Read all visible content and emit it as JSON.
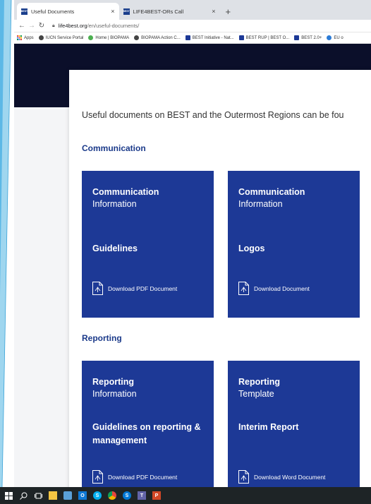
{
  "browser": {
    "tabs": [
      {
        "label": "Useful Documents",
        "favicon": "BEST",
        "active": true
      },
      {
        "label": "LIFE4BEST-ORs Call",
        "favicon": "BEST",
        "active": false
      }
    ],
    "new_tab": "+",
    "close_glyph": "×",
    "url_host": "life4best.org",
    "url_path": "/en/useful-documents/",
    "bookmarks": [
      {
        "label": "Apps",
        "icon": "apps-grid-icon",
        "color": "#e8453c"
      },
      {
        "label": "IUCN Service Portal",
        "icon": "globe-icon",
        "color": "#444444"
      },
      {
        "label": "Home | BIOPAMA",
        "icon": "biopama-icon",
        "color": "#4caf50"
      },
      {
        "label": "BIOPAMA Action C...",
        "icon": "globe-icon",
        "color": "#444444"
      },
      {
        "label": "BEST Initiative - Nat...",
        "icon": "eu-flag-icon",
        "color": "#1d3996"
      },
      {
        "label": "BEST RUP | BEST O...",
        "icon": "best-icon",
        "color": "#1d3996"
      },
      {
        "label": "BEST 2.0+",
        "icon": "best-icon",
        "color": "#1d3996"
      },
      {
        "label": "EU o",
        "icon": "edge-icon",
        "color": "#2b7bd6"
      }
    ]
  },
  "page": {
    "intro": "Useful documents on BEST and the Outermost Regions can be fou",
    "sections": [
      {
        "title": "Communication",
        "tiles": [
          {
            "heading": "Communication",
            "subheading": "Information",
            "name": "Guidelines",
            "download": "Download PDF Document"
          },
          {
            "heading": "Communication",
            "subheading": "Information",
            "name": "Logos",
            "download": "Download Document"
          }
        ]
      },
      {
        "title": "Reporting",
        "tiles": [
          {
            "heading": "Reporting",
            "subheading": "Information",
            "name": "Guidelines on reporting & management",
            "download": "Download PDF Document"
          },
          {
            "heading": "Reporting",
            "subheading": "Template",
            "name": "Interim Report",
            "download": "Download Word Document"
          }
        ]
      }
    ]
  },
  "taskbar": {
    "items": [
      {
        "icon": "windows-start-icon",
        "color": "#ffffff"
      },
      {
        "icon": "search-icon",
        "color": "#ffffff"
      },
      {
        "icon": "task-view-icon",
        "color": "#ffffff"
      },
      {
        "icon": "file-explorer-icon",
        "color": "#f5c542"
      },
      {
        "icon": "app-icon",
        "color": "#5aa0d8"
      },
      {
        "icon": "outlook-icon",
        "color": "#0f78d4"
      },
      {
        "icon": "skype-icon",
        "color": "#00aff0"
      },
      {
        "icon": "chrome-icon",
        "color": "#e8453c"
      },
      {
        "icon": "skype-business-icon",
        "color": "#0078d7"
      },
      {
        "icon": "teams-icon",
        "color": "#6264a7"
      },
      {
        "icon": "powerpoint-icon",
        "color": "#d24726"
      }
    ]
  }
}
